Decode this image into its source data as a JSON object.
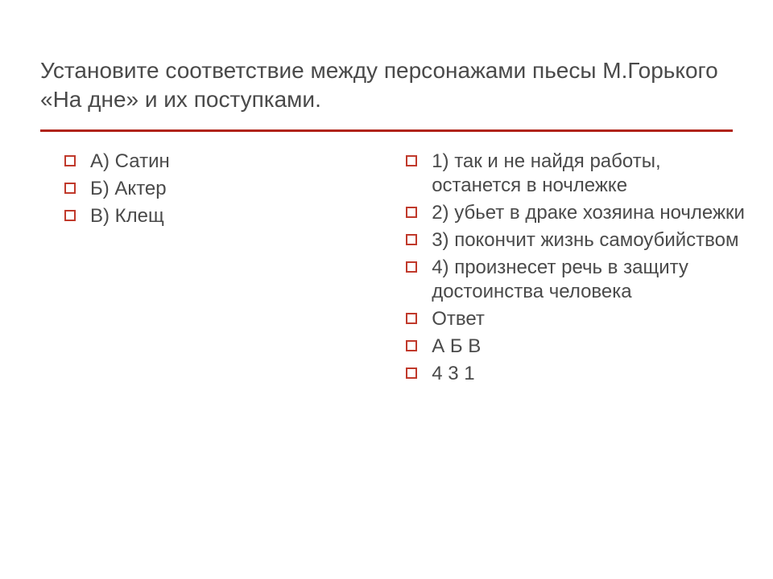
{
  "title": "Установите соответствие между персонажами пьесы М.Горького «На дне» и их поступками.",
  "left_items": [
    "А) Сатин",
    "Б) Актер",
    "В) Клещ"
  ],
  "right_items": [
    "1) так и не  найдя работы, останется в ночлежке",
    "2) убьет в драке хозяина ночлежки",
    "3) покончит жизнь самоубийством",
    "4) произнесет речь в защиту достоинства человека",
    "Ответ",
    "А   Б   В",
    "4   3   1"
  ],
  "colors": {
    "accent": "#b02318",
    "text": "#4a4a4a"
  }
}
